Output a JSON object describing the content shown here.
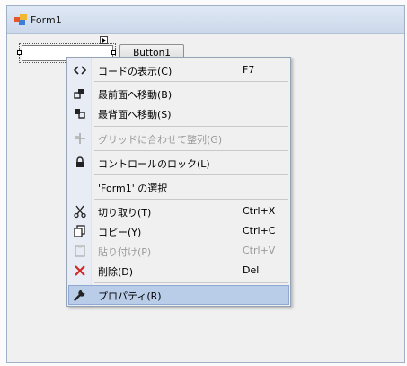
{
  "form": {
    "title": "Form1"
  },
  "controls": {
    "button_label": "Button1"
  },
  "context_menu": {
    "items": [
      {
        "label": "コードの表示(C)",
        "shortcut": "F7",
        "icon": "code-icon",
        "enabled": true
      },
      {
        "label": "最前面へ移動(B)",
        "shortcut": "",
        "icon": "bring-to-front-icon",
        "enabled": true
      },
      {
        "label": "最背面へ移動(S)",
        "shortcut": "",
        "icon": "send-to-back-icon",
        "enabled": true
      },
      {
        "label": "グリッドに合わせて整列(G)",
        "shortcut": "",
        "icon": "align-to-grid-icon",
        "enabled": false
      },
      {
        "label": "コントロールのロック(L)",
        "shortcut": "",
        "icon": "lock-icon",
        "enabled": true
      },
      {
        "label": "'Form1' の選択",
        "shortcut": "",
        "icon": "",
        "enabled": true
      },
      {
        "label": "切り取り(T)",
        "shortcut": "Ctrl+X",
        "icon": "cut-icon",
        "enabled": true
      },
      {
        "label": "コピー(Y)",
        "shortcut": "Ctrl+C",
        "icon": "copy-icon",
        "enabled": true
      },
      {
        "label": "貼り付け(P)",
        "shortcut": "Ctrl+V",
        "icon": "paste-icon",
        "enabled": false
      },
      {
        "label": "削除(D)",
        "shortcut": "Del",
        "icon": "delete-icon",
        "enabled": true
      },
      {
        "label": "プロパティ(R)",
        "shortcut": "",
        "icon": "wrench-icon",
        "enabled": true
      }
    ],
    "highlighted_index": 10
  },
  "colors": {
    "highlight": "#b9cde9",
    "delete_red": "#d32626",
    "disabled_text": "#9a9a9a"
  }
}
